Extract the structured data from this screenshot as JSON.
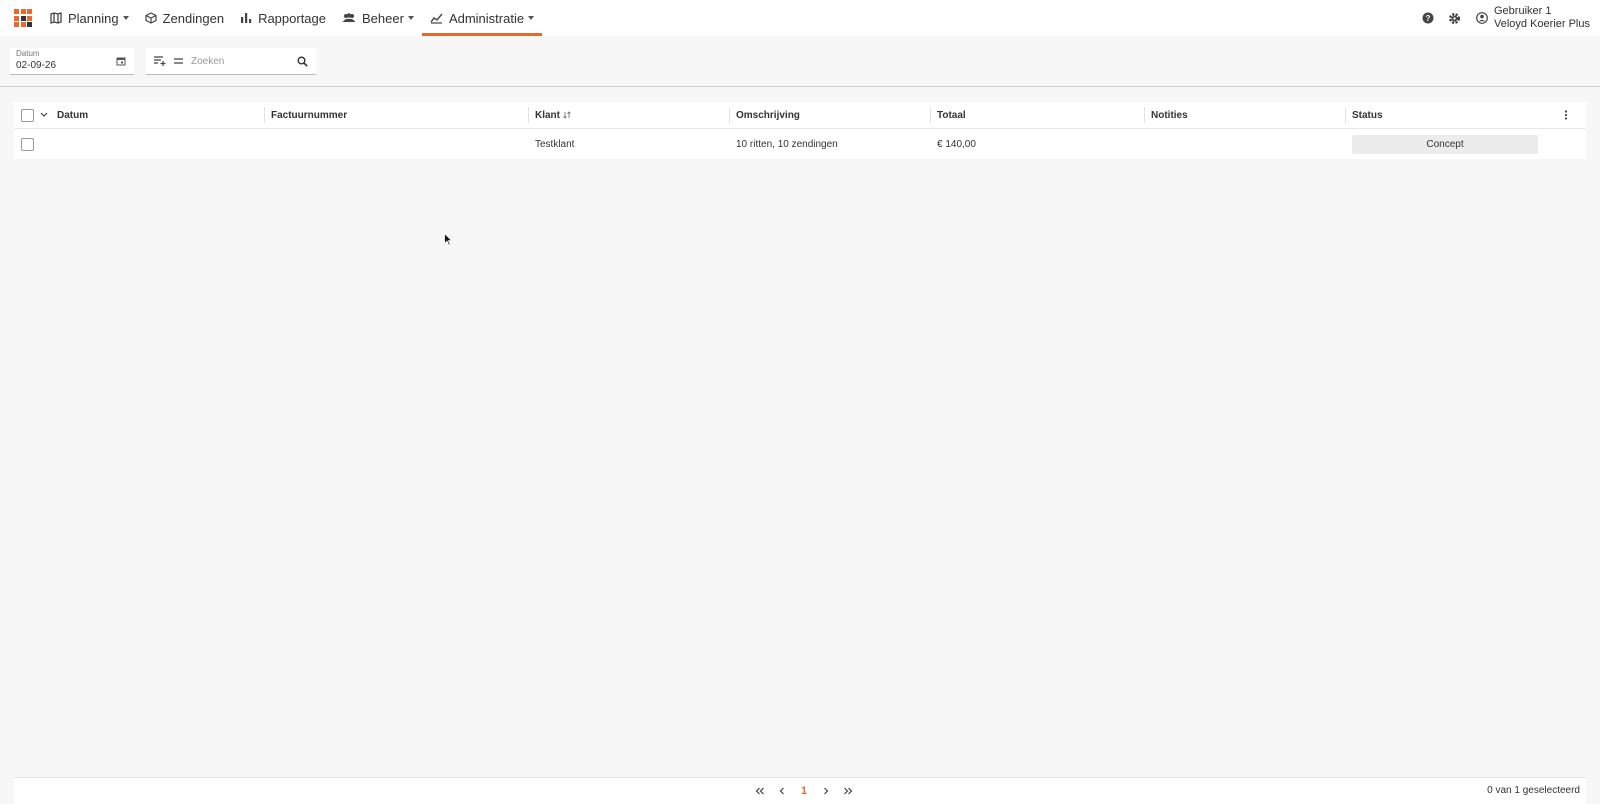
{
  "nav": {
    "items": [
      {
        "label": "Planning",
        "icon": "map-icon",
        "has_menu": true
      },
      {
        "label": "Zendingen",
        "icon": "package-icon",
        "has_menu": false
      },
      {
        "label": "Rapportage",
        "icon": "bar-chart-icon",
        "has_menu": false
      },
      {
        "label": "Beheer",
        "icon": "group-icon",
        "has_menu": true
      },
      {
        "label": "Administratie",
        "icon": "administration-icon",
        "has_menu": true,
        "active": true
      }
    ],
    "accent_color": "#e8692a"
  },
  "user": {
    "name": "Gebruiker 1",
    "company": "Veloyd Koerier Plus"
  },
  "filters": {
    "date_label": "Datum",
    "date_value": "02-09-26",
    "search_placeholder": "Zoeken"
  },
  "table": {
    "columns": [
      "Datum",
      "Factuurnummer",
      "Klant",
      "Omschrijving",
      "Totaal",
      "Notities",
      "Status"
    ],
    "rows": [
      {
        "datum": "",
        "factuurnummer": "",
        "klant": "Testklant",
        "omschrijving": "10 ritten, 10 zendingen",
        "totaal": "€ 140,00",
        "notities": "",
        "status": "Concept"
      }
    ]
  },
  "pagination": {
    "current_page": "1",
    "selection_text": "0 van 1 geselecteerd"
  }
}
